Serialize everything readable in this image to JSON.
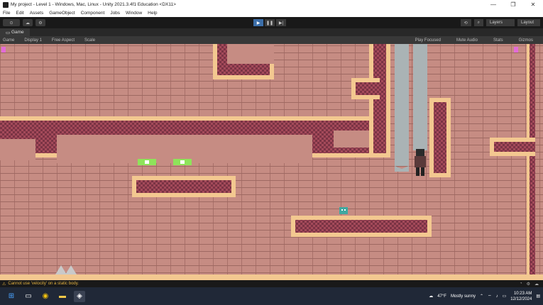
{
  "window": {
    "title": "My project - Level 1 - Windows, Mac, Linux - Unity 2021.3.4f1 Education <DX11>",
    "controls": [
      "—",
      "❐",
      "✕"
    ]
  },
  "menu": [
    "File",
    "Edit",
    "Assets",
    "GameObject",
    "Component",
    "Jobs",
    "Window",
    "Help"
  ],
  "toolbar": {
    "left_buttons": [
      "⊙",
      "☁",
      "⚙"
    ],
    "play": "▶",
    "pause": "❚❚",
    "step": "▶|",
    "layers_label": "Layers",
    "layout_label": "Layout"
  },
  "game_view": {
    "tab_label": "Game",
    "display": "Display 1",
    "aspect": "Free Aspect",
    "scale_label": "Scale",
    "play_focused": "Play Focused",
    "mute_audio": "Mute Audio",
    "stats": "Stats",
    "gizmos": "Gizmos"
  },
  "console": {
    "message": "Cannot use 'velocity' on a static body."
  },
  "taskbar": {
    "weather_temp": "47°F",
    "weather_text": "Mostly sunny",
    "time": "10:23 AM",
    "date": "12/12/2024"
  },
  "colors": {
    "brick": "#c68c83",
    "platform_light": "#f3c890",
    "platform_dark": "#8c3a4a",
    "pillar": "#aab3b5",
    "gem": "#8ee35a"
  }
}
